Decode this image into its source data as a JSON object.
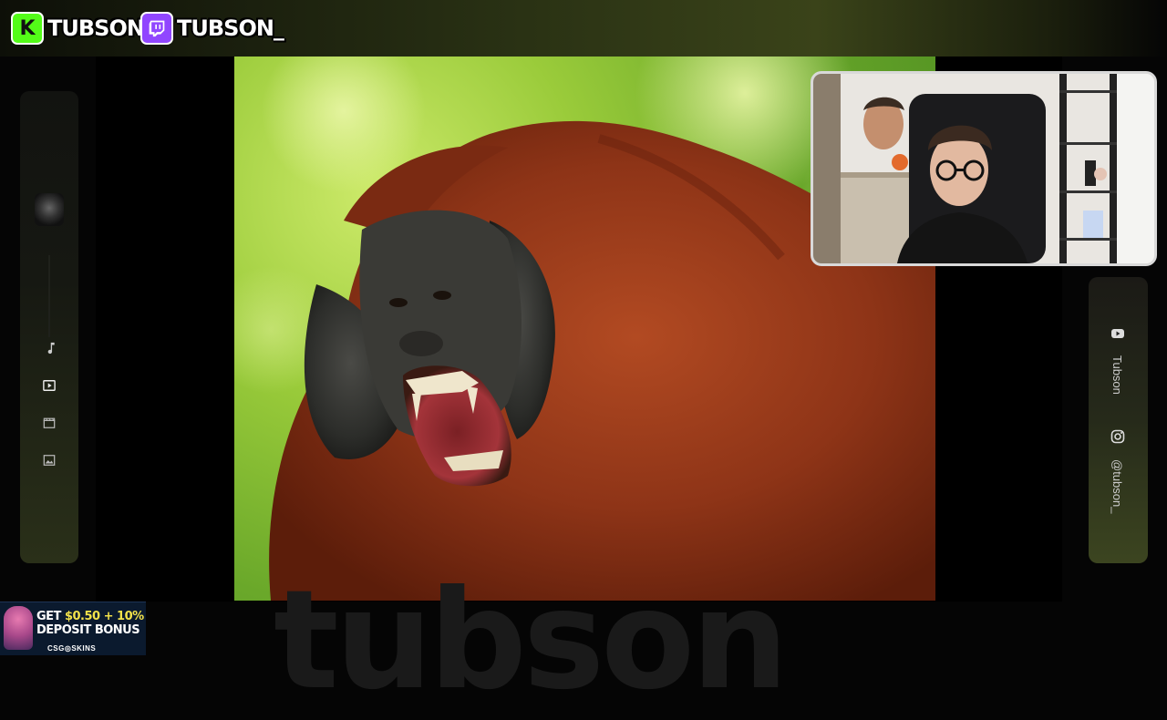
{
  "header": {
    "kick": {
      "badge": "K",
      "handle": "TUBSON",
      "color": "#53fc18"
    },
    "twitch": {
      "handle": "TUBSON_",
      "color": "#9146ff"
    }
  },
  "left_nav": {
    "items": [
      {
        "name": "music",
        "icon": "music-note-icon"
      },
      {
        "name": "video",
        "icon": "play-box-icon",
        "active": true
      },
      {
        "name": "clips",
        "icon": "clapper-icon"
      },
      {
        "name": "images",
        "icon": "image-icon"
      }
    ]
  },
  "main_media": {
    "subject": "orangutan"
  },
  "webcam": {
    "subject": "streamer"
  },
  "right_panel": {
    "youtube": {
      "icon": "youtube-icon",
      "label": "Tubson"
    },
    "instagram": {
      "icon": "instagram-icon",
      "label": "@tubson_"
    }
  },
  "watermark": {
    "text": "tubson"
  },
  "ad": {
    "line1_prefix": "GET ",
    "line1_highlight": "$0.50 + 10%",
    "line2": "DEPOSIT BONUS",
    "brand": "CSG◎SKINS"
  }
}
